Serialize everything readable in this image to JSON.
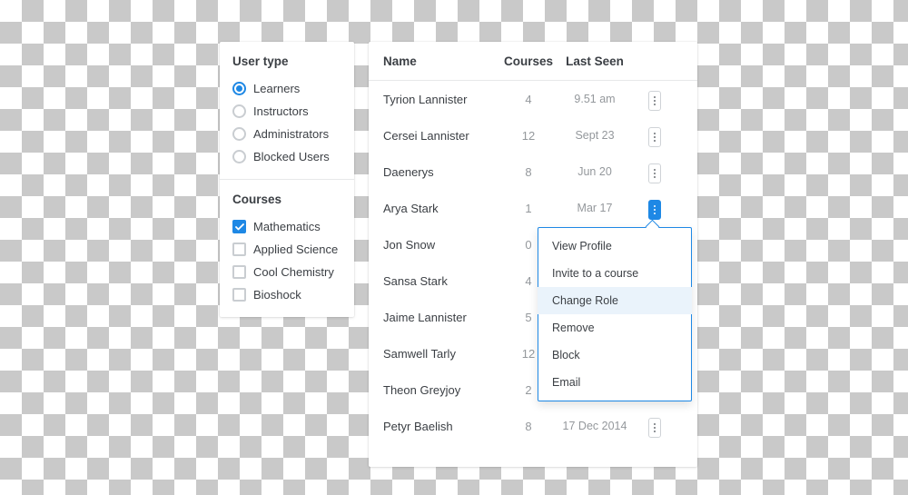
{
  "sidebar": {
    "user_type": {
      "title": "User type",
      "options": [
        {
          "label": "Learners",
          "checked": true
        },
        {
          "label": "Instructors",
          "checked": false
        },
        {
          "label": "Administrators",
          "checked": false
        },
        {
          "label": "Blocked Users",
          "checked": false
        }
      ]
    },
    "courses": {
      "title": "Courses",
      "options": [
        {
          "label": "Mathematics",
          "checked": true
        },
        {
          "label": "Applied Science",
          "checked": false
        },
        {
          "label": "Cool Chemistry",
          "checked": false
        },
        {
          "label": "Bioshock",
          "checked": false
        }
      ]
    }
  },
  "table": {
    "headers": {
      "name": "Name",
      "courses": "Courses",
      "last_seen": "Last Seen"
    },
    "rows": [
      {
        "name": "Tyrion Lannister",
        "courses": "4",
        "last_seen": "9.51 am",
        "menu_open": false
      },
      {
        "name": "Cersei Lannister",
        "courses": "12",
        "last_seen": "Sept 23",
        "menu_open": false
      },
      {
        "name": "Daenerys",
        "courses": "8",
        "last_seen": "Jun 20",
        "menu_open": false
      },
      {
        "name": "Arya Stark",
        "courses": "1",
        "last_seen": "Mar 17",
        "menu_open": true
      },
      {
        "name": "Jon Snow",
        "courses": "0",
        "last_seen": "",
        "menu_open": false
      },
      {
        "name": "Sansa Stark",
        "courses": "4",
        "last_seen": "",
        "menu_open": false
      },
      {
        "name": "Jaime Lannister",
        "courses": "5",
        "last_seen": "",
        "menu_open": false
      },
      {
        "name": "Samwell Tarly",
        "courses": "12",
        "last_seen": "",
        "menu_open": false
      },
      {
        "name": "Theon Greyjoy",
        "courses": "2",
        "last_seen": "",
        "menu_open": false
      },
      {
        "name": "Petyr Baelish",
        "courses": "8",
        "last_seen": "17 Dec 2014",
        "menu_open": false
      }
    ],
    "context_menu": {
      "items": [
        {
          "label": "View Profile",
          "highlight": false
        },
        {
          "label": "Invite to a course",
          "highlight": false
        },
        {
          "label": "Change Role",
          "highlight": true
        },
        {
          "label": "Remove",
          "highlight": false
        },
        {
          "label": "Block",
          "highlight": false
        },
        {
          "label": "Email",
          "highlight": false
        }
      ]
    }
  },
  "colors": {
    "accent": "#1e88e5"
  }
}
